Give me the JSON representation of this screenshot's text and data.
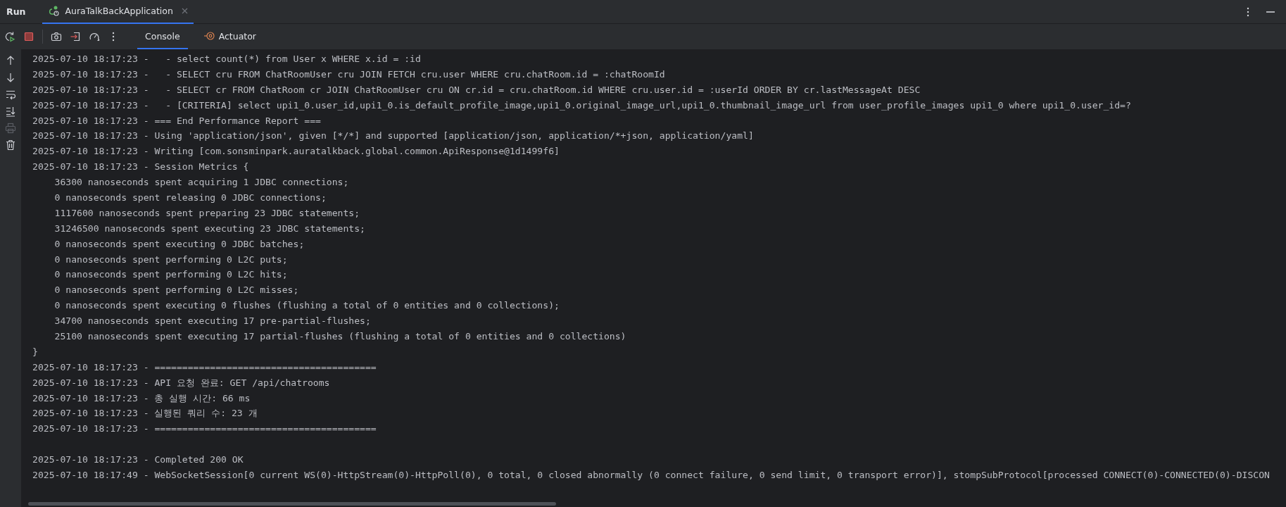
{
  "panel": {
    "title": "Run",
    "tabs": [
      {
        "label": "AuraTalkBackApplication",
        "selected": true
      }
    ]
  },
  "toolbar": {
    "tabs": [
      {
        "label": "Console",
        "selected": true
      },
      {
        "label": "Actuator",
        "selected": false
      }
    ]
  },
  "console": {
    "blocks": [
      {
        "lines": [
          {
            "text": "2025-07-10 18:17:23 -   - select count(*) from User x WHERE x.id = :id"
          },
          {
            "text": "2025-07-10 18:17:23 -   - SELECT cru FROM ChatRoomUser cru JOIN FETCH cru.user WHERE cru.chatRoom.id = :chatRoomId"
          },
          {
            "text": "2025-07-10 18:17:23 -   - SELECT cr FROM ChatRoom cr JOIN ChatRoomUser cru ON cr.id = cru.chatRoom.id WHERE cru.user.id = :userId ORDER BY cr.lastMessageAt DESC"
          },
          {
            "text": "2025-07-10 18:17:23 -   - [CRITERIA] select upi1_0.user_id,upi1_0.is_default_profile_image,upi1_0.original_image_url,upi1_0.thumbnail_image_url from user_profile_images upi1_0 where upi1_0.user_id=?"
          },
          {
            "text": "2025-07-10 18:17:23 - === End Performance Report ==="
          },
          {
            "text": "2025-07-10 18:17:23 - Using 'application/json', given [*/*] and supported [application/json, application/*+json, application/yaml]"
          },
          {
            "text": "2025-07-10 18:17:23 - Writing [com.sonsminpark.auratalkback.global.common.ApiResponse@1d1499f6]"
          },
          {
            "text": "2025-07-10 18:17:23 - Session Metrics {"
          },
          {
            "text": "    36300 nanoseconds spent acquiring 1 JDBC connections;"
          },
          {
            "text": "    0 nanoseconds spent releasing 0 JDBC connections;"
          },
          {
            "text": "    1117600 nanoseconds spent preparing 23 JDBC statements;"
          },
          {
            "text": "    31246500 nanoseconds spent executing 23 JDBC statements;"
          },
          {
            "text": "    0 nanoseconds spent executing 0 JDBC batches;"
          },
          {
            "text": "    0 nanoseconds spent performing 0 L2C puts;"
          },
          {
            "text": "    0 nanoseconds spent performing 0 L2C hits;"
          },
          {
            "text": "    0 nanoseconds spent performing 0 L2C misses;"
          },
          {
            "text": "    0 nanoseconds spent executing 0 flushes (flushing a total of 0 entities and 0 collections);"
          },
          {
            "text": "    34700 nanoseconds spent executing 17 pre-partial-flushes;"
          },
          {
            "text": "    25100 nanoseconds spent executing 17 partial-flushes (flushing a total of 0 entities and 0 collections)"
          },
          {
            "text": "}"
          },
          {
            "text": "2025-07-10 18:17:23 - ========================================"
          },
          {
            "text": "2025-07-10 18:17:23 - API 요청 완료: GET /api/chatrooms"
          },
          {
            "text": "2025-07-10 18:17:23 - 총 실행 시간: 66 ms"
          },
          {
            "text": "2025-07-10 18:17:23 - 실행된 쿼리 수: 23 개"
          },
          {
            "text": "2025-07-10 18:17:23 - ========================================"
          }
        ]
      },
      {
        "lines": [
          {
            "text": "2025-07-10 18:17:23 - Completed 200 OK"
          },
          {
            "text": "2025-07-10 18:17:49 - WebSocketSession[0 current WS(0)-HttpStream(0)-HttpPoll(0), 0 total, 0 closed abnormally (0 connect failure, 0 send limit, 0 transport error)], stompSubProtocol[processed CONNECT(0)-CONNECTED(0)-DISCON"
          }
        ]
      }
    ]
  }
}
